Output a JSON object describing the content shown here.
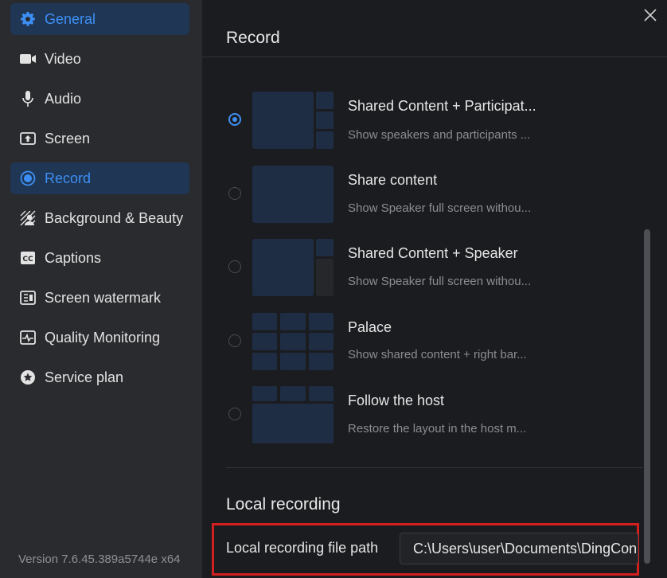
{
  "sidebar": {
    "items": [
      {
        "label": "General",
        "icon": "gear-icon",
        "active": true
      },
      {
        "label": "Video",
        "icon": "video-camera-icon",
        "active": false
      },
      {
        "label": "Audio",
        "icon": "microphone-icon",
        "active": false
      },
      {
        "label": "Screen",
        "icon": "screen-share-icon",
        "active": false
      },
      {
        "label": "Record",
        "icon": "record-icon",
        "active": true
      },
      {
        "label": "Background & Beauty",
        "icon": "background-icon",
        "active": false
      },
      {
        "label": "Captions",
        "icon": "captions-icon",
        "active": false
      },
      {
        "label": "Screen watermark",
        "icon": "watermark-icon",
        "active": false
      },
      {
        "label": "Quality Monitoring",
        "icon": "pulse-icon",
        "active": false
      },
      {
        "label": "Service plan",
        "icon": "star-icon",
        "active": false
      }
    ],
    "version": "Version 7.6.45.389a5744e x64"
  },
  "main": {
    "title": "Record",
    "layouts": [
      {
        "title": "Shared Content + Participat...",
        "desc": "Show speakers and participants ...",
        "selected": true
      },
      {
        "title": "Share content",
        "desc": "Show Speaker full screen withou...",
        "selected": false
      },
      {
        "title": "Shared Content + Speaker",
        "desc": "Show Speaker full screen withou...",
        "selected": false
      },
      {
        "title": "Palace",
        "desc": "Show shared content + right bar...",
        "selected": false
      },
      {
        "title": "Follow the host",
        "desc": "Restore the layout in the host m...",
        "selected": false
      }
    ],
    "local_recording": {
      "section_title": "Local recording",
      "path_label": "Local recording file path",
      "path_value": "C:\\Users\\user\\Documents\\DingConnect"
    }
  },
  "colors": {
    "accent": "#3d8ff5",
    "highlight": "#d41f1f",
    "active_bg": "#1f3654",
    "thumb_bg": "#1e2d44"
  }
}
